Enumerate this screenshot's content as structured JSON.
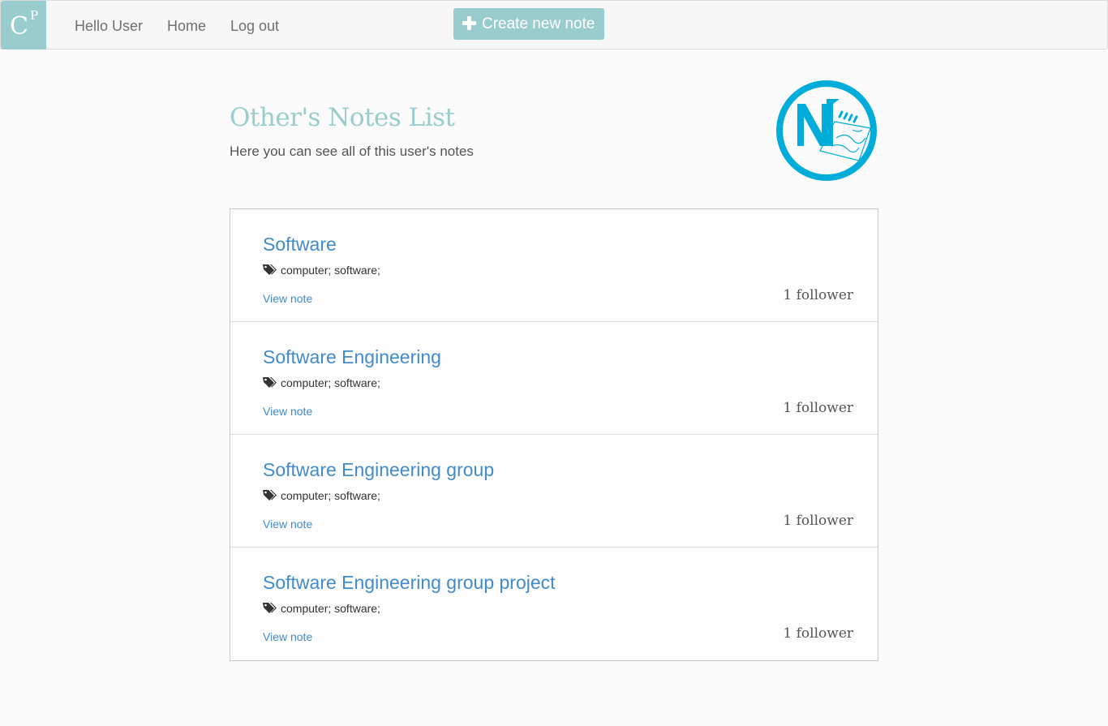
{
  "brand": {
    "letter": "C",
    "superscript": "P"
  },
  "nav": {
    "greeting": "Hello User",
    "home": "Home",
    "logout": "Log out",
    "create_button": "Create new note"
  },
  "header": {
    "title": "Other's Notes List",
    "subtitle": "Here you can see all of this user's notes"
  },
  "colors": {
    "accent": "#99cccc",
    "link": "#428bca",
    "logo": "#00acd9"
  },
  "notes": [
    {
      "title": "Software",
      "tags": "computer; software;",
      "view_label": "View note",
      "followers": "1 follower"
    },
    {
      "title": "Software Engineering",
      "tags": "computer; software;",
      "view_label": "View note",
      "followers": "1 follower"
    },
    {
      "title": "Software Engineering group",
      "tags": "computer; software;",
      "view_label": "View note",
      "followers": "1 follower"
    },
    {
      "title": "Software Engineering group project",
      "tags": "computer; software;",
      "view_label": "View note",
      "followers": "1 follower"
    }
  ]
}
